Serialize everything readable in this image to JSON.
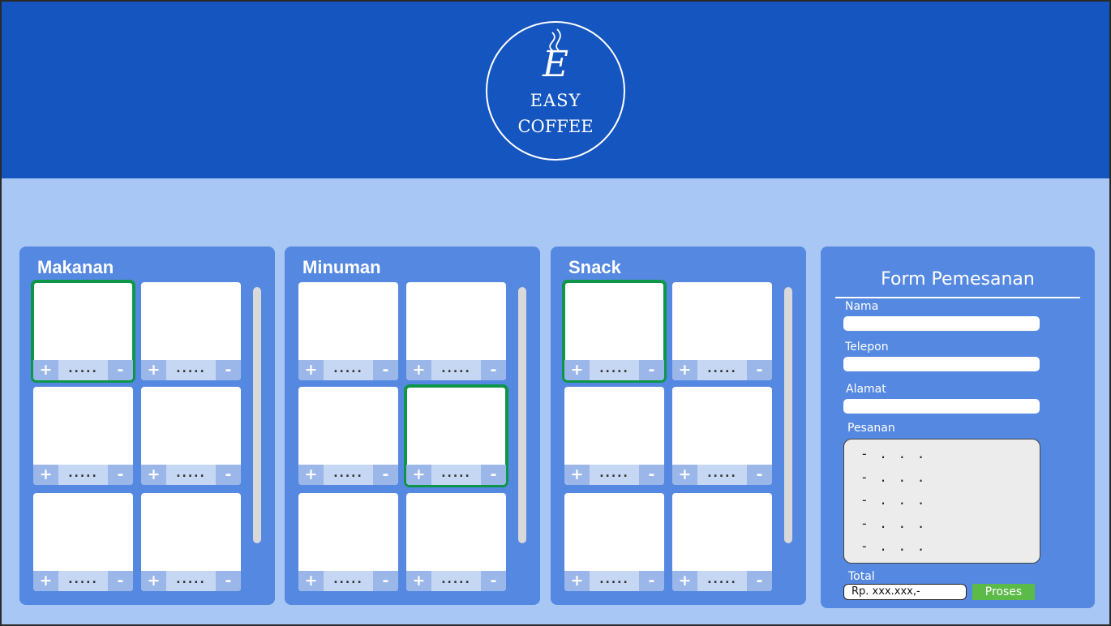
{
  "brand": {
    "mark": "E",
    "line1": "EASY",
    "line2": "COFFEE"
  },
  "menu": {
    "qty_placeholder": ".....",
    "plus_label": "+",
    "minus_label": "-",
    "sections": [
      {
        "title": "Makanan",
        "selected": [
          0
        ]
      },
      {
        "title": "Minuman",
        "selected": [
          3
        ]
      },
      {
        "title": "Snack",
        "selected": [
          0
        ]
      }
    ]
  },
  "form": {
    "title": "Form Pemesanan",
    "nama_label": "Nama",
    "telepon_label": "Telepon",
    "alamat_label": "Alamat",
    "pesanan_label": "Pesanan",
    "pesanan_lines": [
      "- . . .",
      "- . . .",
      "- . . .",
      "- . . .",
      "- . . ."
    ],
    "total_label": "Total",
    "total_value": "Rp. xxx.xxx,-",
    "proses_label": "Proses"
  },
  "colors": {
    "header": "#1455c0",
    "background": "#a8c7f4",
    "panel": "#5588e0",
    "selected_border": "#0d9648",
    "proses_button": "#5cba48"
  }
}
